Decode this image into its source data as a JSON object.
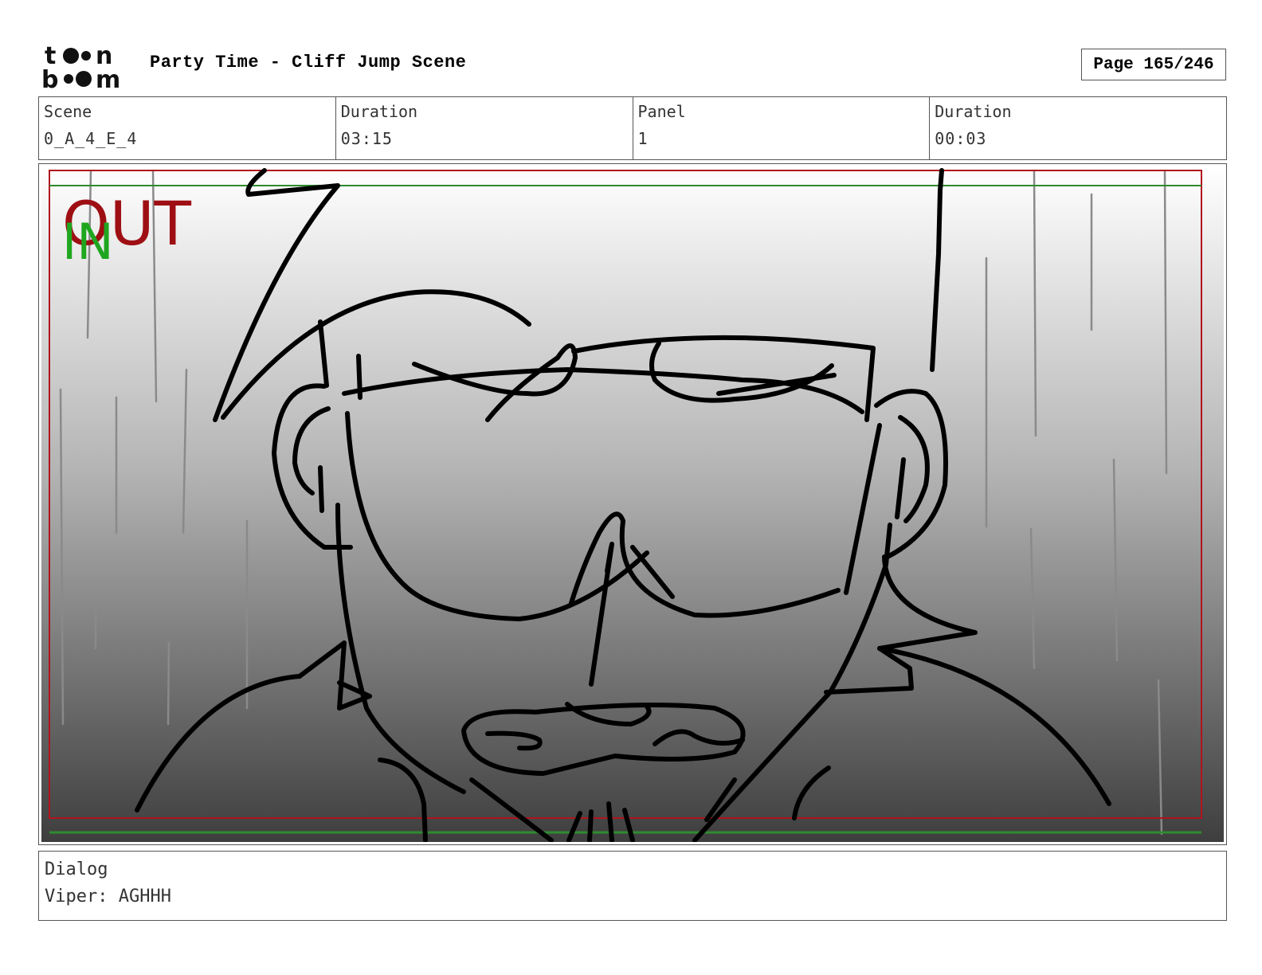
{
  "header": {
    "logo_text": "toon boom",
    "title": "Party Time - Cliff Jump Scene",
    "page": "Page 165/246"
  },
  "info": {
    "scene_label": "Scene",
    "scene_value": "0_A_4_E_4",
    "scene_duration_label": "Duration",
    "scene_duration_value": "03:15",
    "panel_label": "Panel",
    "panel_value": "1",
    "panel_duration_label": "Duration",
    "panel_duration_value": "00:03"
  },
  "panel": {
    "out_marker": "OUT",
    "in_marker": "IN",
    "colors": {
      "safe_frame": "#b0131d",
      "title_safe": "#2e8b2e",
      "in_marker": "#1fa61f",
      "out_marker": "#9e0f14"
    }
  },
  "dialog": {
    "label": "Dialog",
    "text": "Viper: AGHHH"
  }
}
